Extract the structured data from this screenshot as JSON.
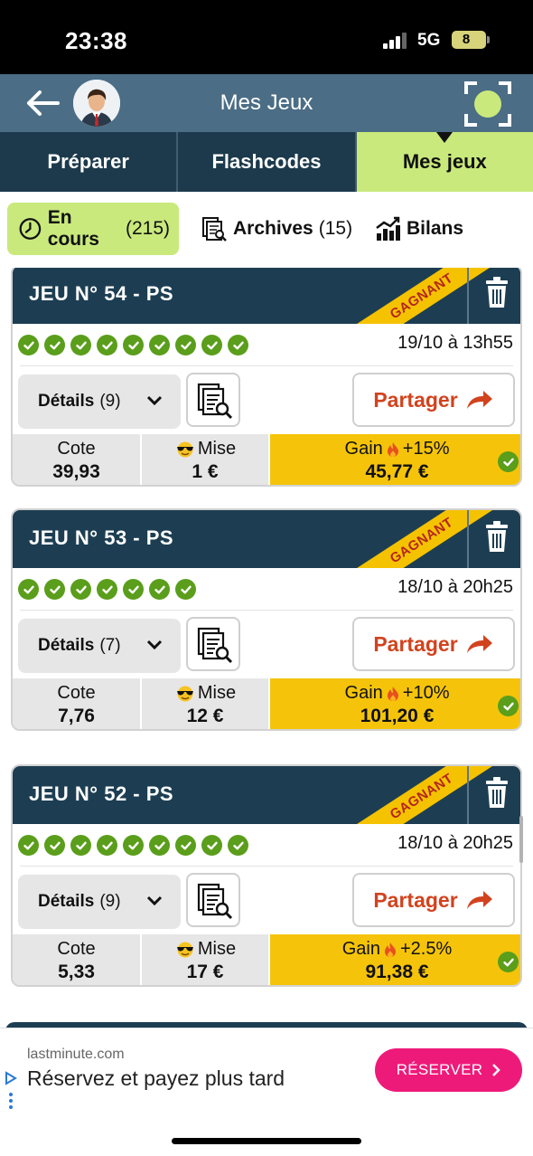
{
  "status_bar": {
    "time": "23:38",
    "network": "5G",
    "battery": "8"
  },
  "app_bar": {
    "title": "Mes Jeux"
  },
  "tabs": [
    {
      "label": "Préparer"
    },
    {
      "label": "Flashcodes"
    },
    {
      "label": "Mes jeux"
    }
  ],
  "filters": [
    {
      "label": "En cours",
      "count": "(215)",
      "icon": "clock-icon"
    },
    {
      "label": "Archives",
      "count": "(15)",
      "icon": "archive-icon"
    },
    {
      "label": "Bilans",
      "count": "",
      "icon": "chart-icon"
    }
  ],
  "labels": {
    "details": "Détails",
    "share": "Partager",
    "cote": "Cote",
    "mise": "Mise",
    "gain": "Gain",
    "ribbon": "GAGNANT"
  },
  "cards": [
    {
      "title": "JEU N° 54 - PS",
      "checks": 9,
      "date": "19/10 à 13h55",
      "details_count": "(9)",
      "cote": "39,93",
      "mise": "1 €",
      "gain_pct": "+15%",
      "gain": "45,77 €"
    },
    {
      "title": "JEU N° 53 - PS",
      "checks": 7,
      "date": "18/10 à 20h25",
      "details_count": "(7)",
      "cote": "7,76",
      "mise": "12 €",
      "gain_pct": "+10%",
      "gain": "101,20 €"
    },
    {
      "title": "JEU N° 52 - PS",
      "checks": 9,
      "date": "18/10 à 20h25",
      "details_count": "(9)",
      "cote": "5,33",
      "mise": "17 €",
      "gain_pct": "+2.5%",
      "gain": "91,38 €"
    }
  ],
  "ad": {
    "source": "lastminute.com",
    "text": "Réservez et payez plus tard",
    "cta": "RÉSERVER"
  },
  "colors": {
    "app_bar": "#4b6d85",
    "tabs_bg": "#1c3a4c",
    "accent_green": "#c9e97c",
    "card_header": "#1d3e52",
    "gain_yellow": "#f5c40a",
    "share_red": "#d1431e",
    "check_green": "#5a9e1b",
    "ad_pink": "#ee1a7a"
  }
}
